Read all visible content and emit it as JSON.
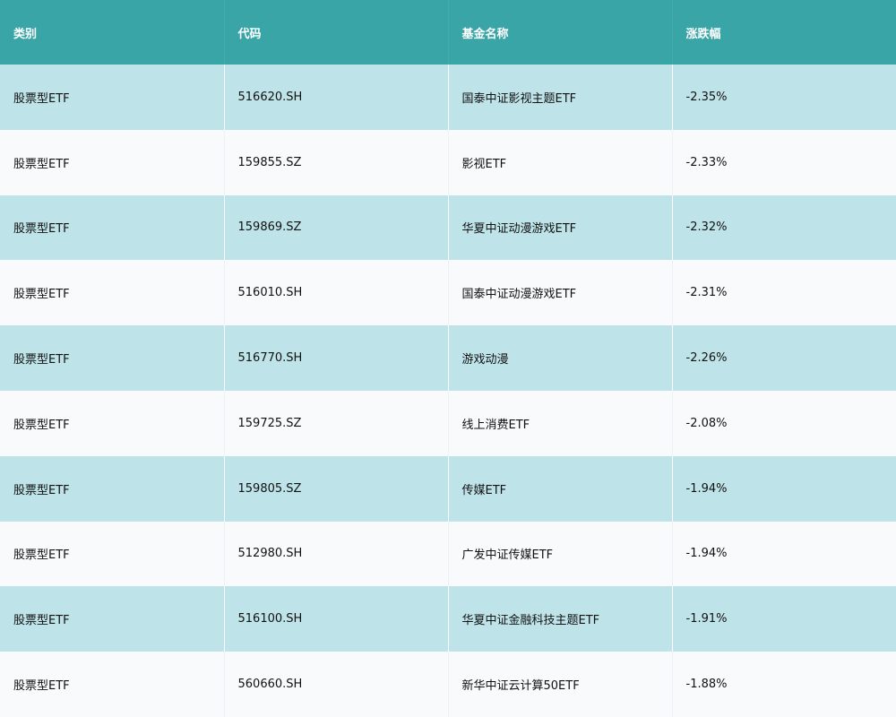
{
  "chart_data": {
    "type": "table",
    "columns": [
      "类别",
      "代码",
      "基金名称",
      "涨跌幅"
    ],
    "rows": [
      [
        "股票型ETF",
        "516620.SH",
        "国泰中证影视主题ETF",
        "-2.35%"
      ],
      [
        "股票型ETF",
        "159855.SZ",
        "影视ETF",
        "-2.33%"
      ],
      [
        "股票型ETF",
        "159869.SZ",
        "华夏中证动漫游戏ETF",
        "-2.32%"
      ],
      [
        "股票型ETF",
        "516010.SH",
        "国泰中证动漫游戏ETF",
        "-2.31%"
      ],
      [
        "股票型ETF",
        "516770.SH",
        "游戏动漫",
        "-2.26%"
      ],
      [
        "股票型ETF",
        "159725.SZ",
        "线上消费ETF",
        "-2.08%"
      ],
      [
        "股票型ETF",
        "159805.SZ",
        "传媒ETF",
        "-1.94%"
      ],
      [
        "股票型ETF",
        "512980.SH",
        "广发中证传媒ETF",
        "-1.94%"
      ],
      [
        "股票型ETF",
        "516100.SH",
        "华夏中证金融科技主题ETF",
        "-1.91%"
      ],
      [
        "股票型ETF",
        "560660.SH",
        "新华中证云计算50ETF",
        "-1.88%"
      ]
    ]
  },
  "colors": {
    "header_bg": "#3aa5a7",
    "header_text": "#ffffff",
    "row_odd_bg": "#bee4e9",
    "row_even_bg": "#f8fafc",
    "cell_text": "#111111"
  }
}
